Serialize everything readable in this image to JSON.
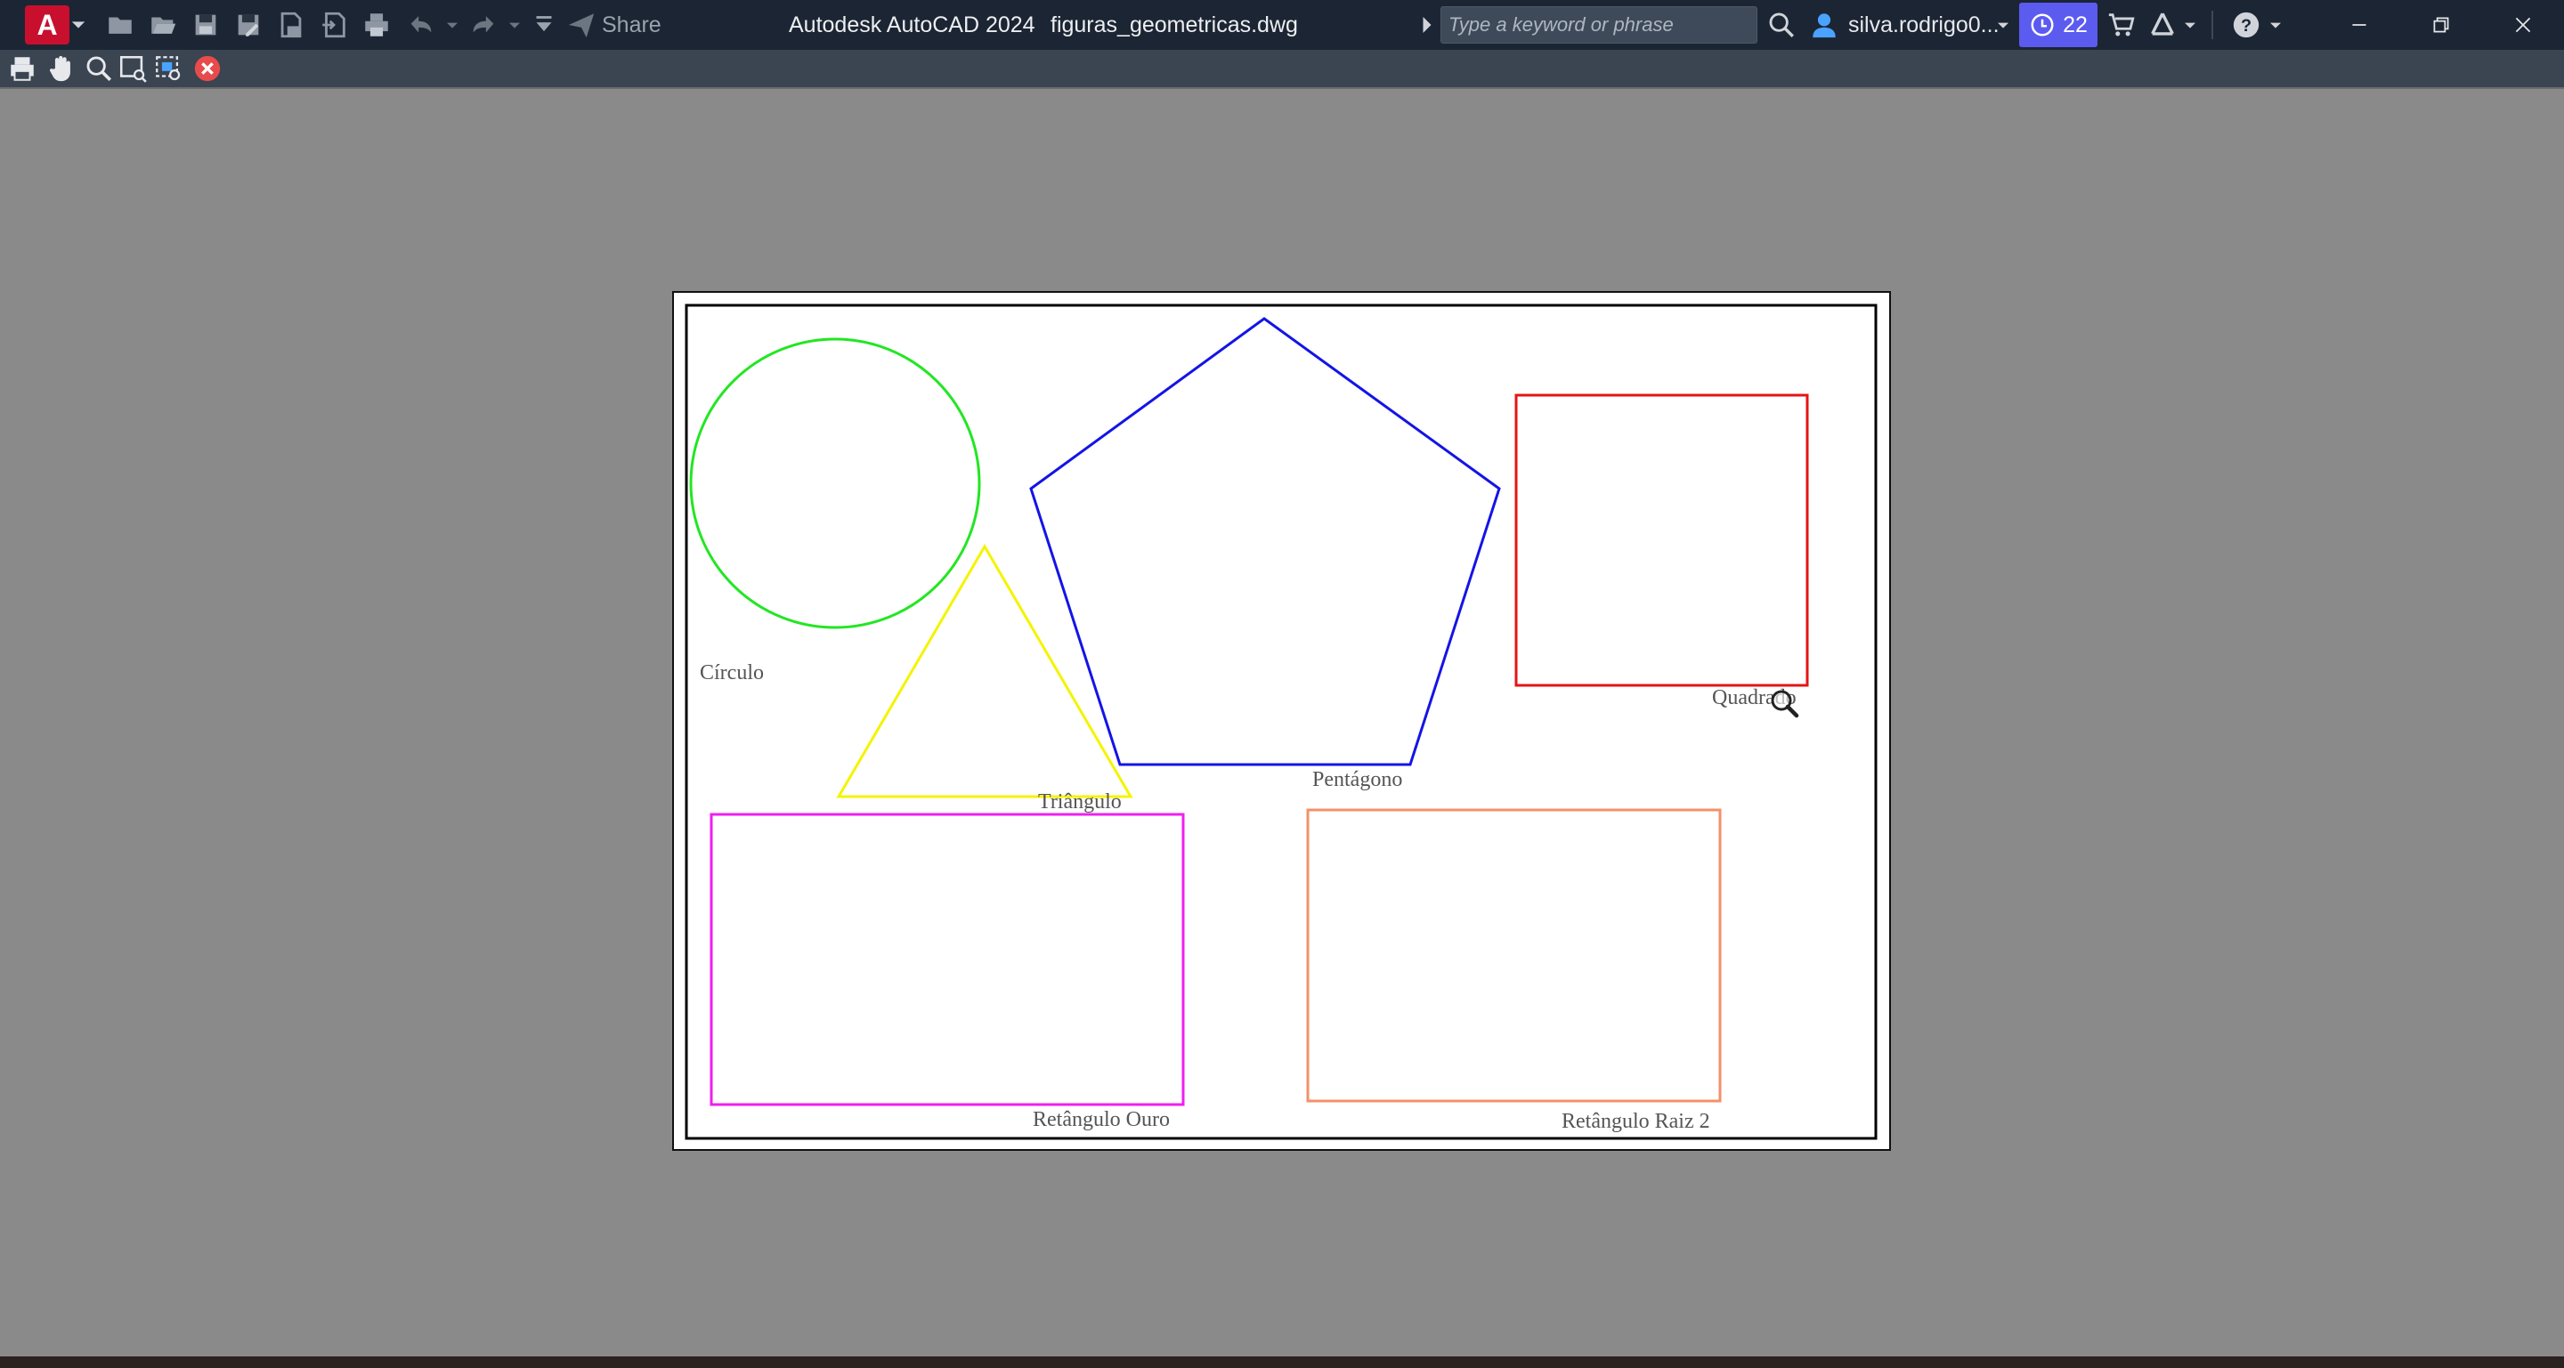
{
  "titlebar": {
    "app_letter": "A",
    "share_label": "Share",
    "app_name": "Autodesk AutoCAD 2024",
    "file_name": "figuras_geometricas.dwg",
    "search_placeholder": "Type a keyword or phrase",
    "user_name": "silva.rodrigo0...",
    "clock_count": "22",
    "colors": {
      "bar": "#1c2533",
      "logo": "#c8102e",
      "clock": "#5b5bf0"
    }
  },
  "toolbar": {
    "icons": [
      "print-icon",
      "pan-hand-icon",
      "zoom-icon",
      "zoom-window-icon",
      "zoom-previous-icon",
      "close-preview-icon"
    ]
  },
  "drawing": {
    "shapes": [
      {
        "name": "circle",
        "color": "#22e622",
        "label": "Círculo"
      },
      {
        "name": "triangle",
        "color": "#f4f400",
        "label": "Triângulo"
      },
      {
        "name": "pentagon",
        "color": "#1414e6",
        "label": "Pentágono"
      },
      {
        "name": "square",
        "color": "#e61414",
        "label": "Quadrado"
      },
      {
        "name": "golden-rectangle",
        "color": "#f01ef0",
        "label": "Retângulo Ouro"
      },
      {
        "name": "root2-rectangle",
        "color": "#f4906a",
        "label": "Retângulo Raiz 2"
      }
    ]
  }
}
